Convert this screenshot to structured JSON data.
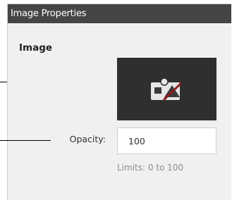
{
  "panel": {
    "title": "Image Properties",
    "section_heading": "Image",
    "thumbnail_icon": "image-broken-icon",
    "opacity": {
      "label": "Opacity:",
      "value": "100",
      "limits": "Limits: 0 to 100"
    }
  },
  "colors": {
    "titlebar_bg": "#454545",
    "panel_bg": "#f0f0f0",
    "thumbnail_bg": "#2f2f2f",
    "icon_slash": "#8b1c1c"
  }
}
